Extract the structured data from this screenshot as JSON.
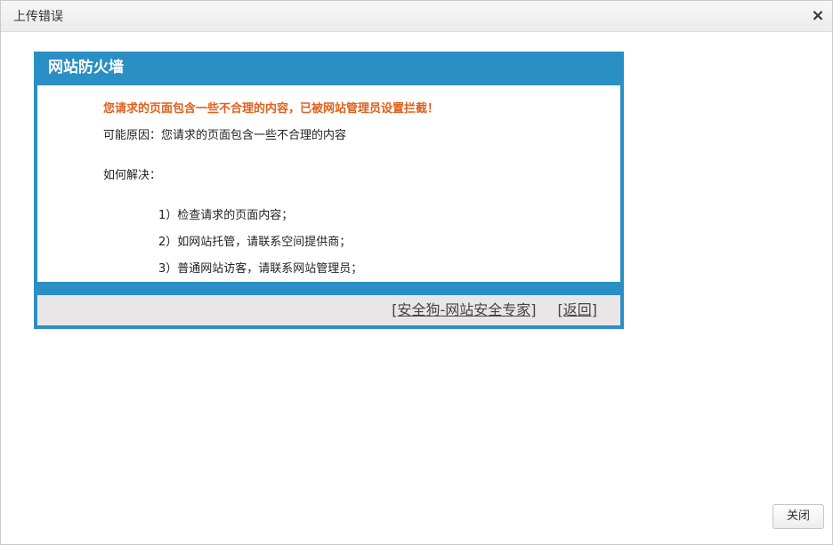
{
  "dialog": {
    "title": "上传错误",
    "close_icon": "×",
    "close_button_label": "关闭"
  },
  "firewall": {
    "header": "网站防火墙",
    "warning": "您请求的页面包含一些不合理的内容，已被网站管理员设置拦截！",
    "reason": "可能原因：您请求的页面包含一些不合理的内容",
    "how_to_resolve": "如何解决：",
    "steps": [
      "1）检查请求的页面内容；",
      "2）如网站托管，请联系空间提供商；",
      "3）普通网站访客，请联系网站管理员；"
    ],
    "footer_links": {
      "safedog": "[安全狗-网站安全专家]",
      "back": "[返回]"
    }
  },
  "colors": {
    "firewall_blue": "#2a8fc4",
    "warning_orange": "#e0601a",
    "footer_gray": "#e8e6e6"
  }
}
